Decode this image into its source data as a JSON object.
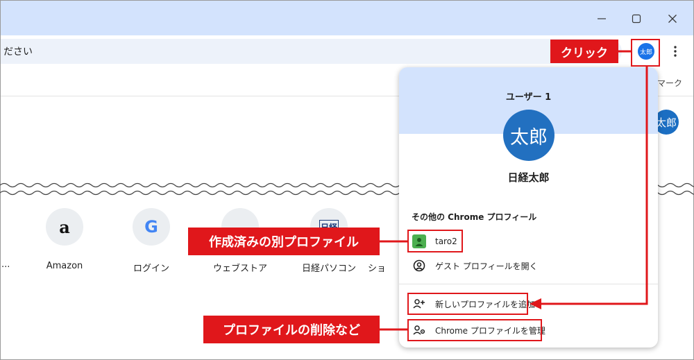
{
  "window": {
    "minimize_icon": "minimize-icon",
    "maximize_icon": "maximize-icon",
    "close_icon": "close-icon"
  },
  "toolbar": {
    "omnibox_text": "ださい",
    "profile_avatar_text": "太郎",
    "menu_icon": "kebab-menu-icon"
  },
  "bookmarks_bar": {
    "partial_item": "マーク"
  },
  "page": {
    "avatar_text": "太郎",
    "shortcuts": [
      {
        "label": "Amazon",
        "glyph": "a",
        "color": "#111111"
      },
      {
        "label": "ログイン",
        "glyph": "G",
        "color": "#4285f4"
      },
      {
        "label": "ウェブストア",
        "glyph": "",
        "color": "#9aa0a6"
      },
      {
        "label": "日経パソコン",
        "glyph": "日経",
        "color": "#1a3a7a"
      },
      {
        "label": "ショ",
        "glyph": "",
        "color": "#9aa0a6"
      }
    ],
    "partial_left_label": "..."
  },
  "profile_menu": {
    "user_title": "ユーザー 1",
    "avatar_text": "太郎",
    "name": "日経太郎",
    "other_profiles_heading": "その他の Chrome プロフィール",
    "other_profiles": [
      {
        "label": "taro2"
      }
    ],
    "guest_label": "ゲスト プロフィールを開く",
    "add_label": "新しいプロファイルを追加",
    "manage_label": "Chrome プロファイルを管理"
  },
  "annotations": {
    "click": "クリック",
    "created_profile": "作成済みの別プロファイル",
    "delete_profile": "プロファイルの削除など"
  },
  "colors": {
    "accent_red": "#e0171b",
    "header_blue": "#d3e3fd",
    "avatar_blue": "#2270c0"
  }
}
